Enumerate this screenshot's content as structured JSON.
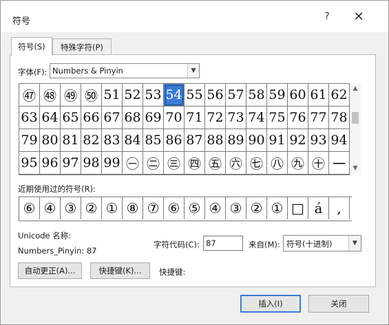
{
  "window": {
    "title": "符号",
    "help": "?",
    "close": "✕"
  },
  "tabs": [
    {
      "label": "符号(S)"
    },
    {
      "label": "特殊字符(P)"
    }
  ],
  "font": {
    "label": "字体(F):",
    "value": "Numbers & Pinyin"
  },
  "grid": {
    "rows": [
      [
        "㊼",
        "㊽",
        "㊾",
        "㊿",
        "51",
        "52",
        "53",
        "54",
        "55",
        "56",
        "57",
        "58",
        "59",
        "60",
        "61",
        "62"
      ],
      [
        "63",
        "64",
        "65",
        "66",
        "67",
        "68",
        "69",
        "70",
        "71",
        "72",
        "73",
        "74",
        "75",
        "76",
        "77",
        "78"
      ],
      [
        "79",
        "80",
        "81",
        "82",
        "83",
        "84",
        "85",
        "86",
        "87",
        "88",
        "89",
        "90",
        "91",
        "92",
        "93",
        "94"
      ],
      [
        "95",
        "96",
        "97",
        "98",
        "99",
        "㊀",
        "㊁",
        "㊂",
        "㊃",
        "㊄",
        "㊅",
        "㊆",
        "㊇",
        "㊈",
        "㊉",
        "一"
      ]
    ],
    "display_rows": [
      [
        "㊼",
        "㊽",
        "㊾",
        "㊿",
        "⑤①",
        "⑤②",
        "⑤③",
        "⑤④",
        "⑤⑤",
        "⑤⑥",
        "⑤⑦",
        "⑤⑧",
        "⑤⑨",
        "⑥⓪",
        "⑥①",
        "⑥②"
      ],
      [],
      [],
      []
    ],
    "selected": {
      "row": 0,
      "col": 7
    }
  },
  "recent": {
    "label": "近期使用过的符号(R):",
    "symbols": [
      "⑥",
      "④",
      "③",
      "②",
      "①",
      "⑧",
      "⑦",
      "⑥",
      "⑤",
      "④",
      "③",
      "②",
      "①",
      "□",
      "á",
      ","
    ]
  },
  "unicode": {
    "label": "Unicode 名称:",
    "name": "Numbers_Pinyin: 87"
  },
  "char_code": {
    "label": "字符代码(C):",
    "value": "87"
  },
  "from": {
    "label": "来自(M):",
    "value": "符号(十进制)"
  },
  "buttons": {
    "autocorrect": "自动更正(A)...",
    "shortcut": "快捷键(K)...",
    "shortcut_label": "快捷键:",
    "insert": "插入(I)",
    "close": "关闭"
  },
  "colors": {
    "selection": "#3a7bd5"
  },
  "icons": {
    "dropdown": "chevron-down-icon",
    "scroll_up": "chevron-up-icon",
    "scroll_down": "chevron-down-icon"
  }
}
